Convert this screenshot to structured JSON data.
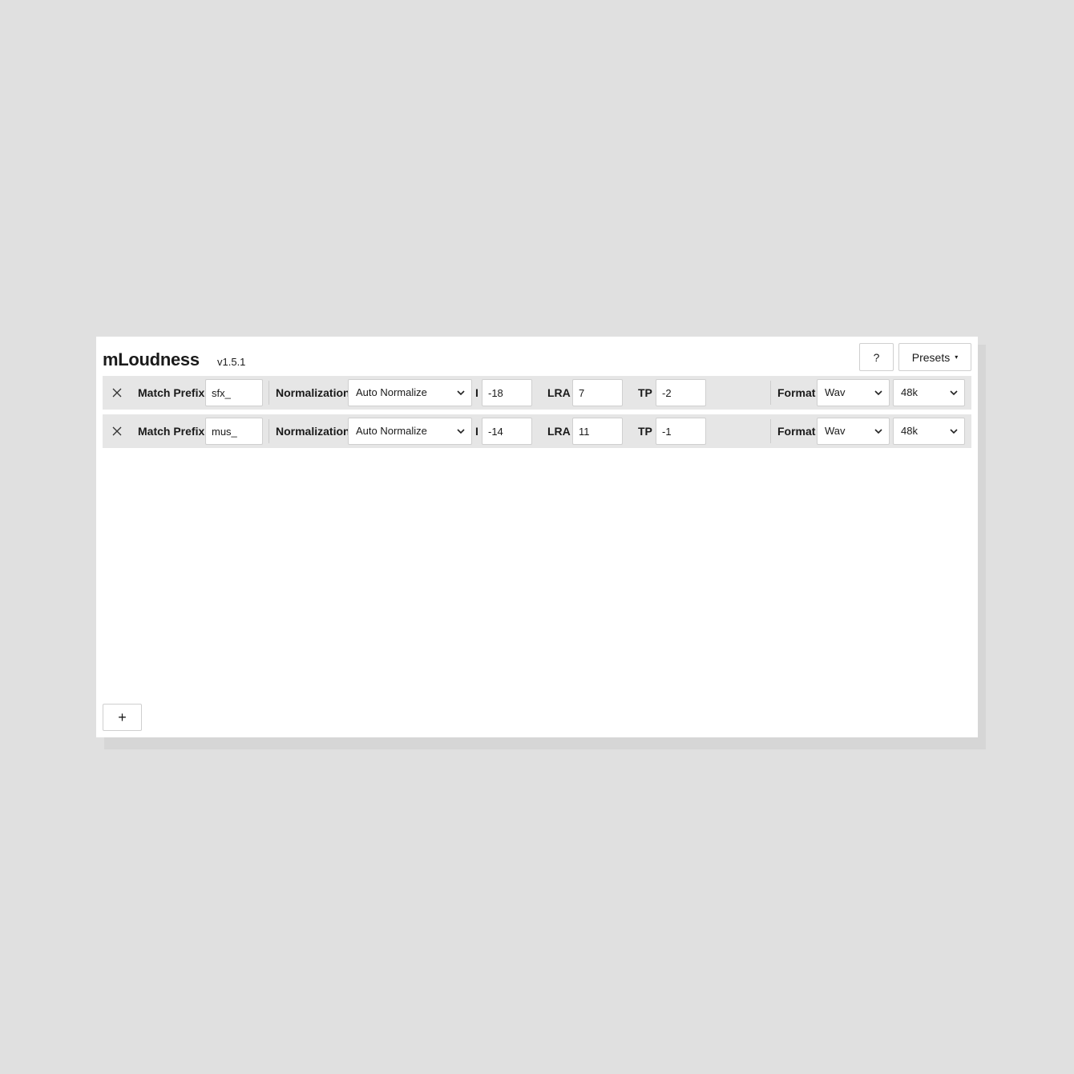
{
  "header": {
    "title": "mLoudness",
    "version": "v1.5.1",
    "help_label": "?",
    "presets_label": "Presets",
    "presets_caret": "▾"
  },
  "rows": [
    {
      "remove_label": "×",
      "match_prefix_label": "Match Prefix",
      "match_prefix_value": "sfx_",
      "normalization_label": "Normalization",
      "normalization_value": "Auto Normalize",
      "i_label": "I",
      "i_value": "-18",
      "lra_label": "LRA",
      "lra_value": "7",
      "tp_label": "TP",
      "tp_value": "-2",
      "format_label": "Format",
      "format_value": "Wav",
      "sample_rate_value": "48k"
    },
    {
      "remove_label": "×",
      "match_prefix_label": "Match Prefix",
      "match_prefix_value": "mus_",
      "normalization_label": "Normalization",
      "normalization_value": "Auto Normalize",
      "i_label": "I",
      "i_value": "-14",
      "lra_label": "LRA",
      "lra_value": "11",
      "tp_label": "TP",
      "tp_value": "-1",
      "format_label": "Format",
      "format_value": "Wav",
      "sample_rate_value": "48k"
    }
  ],
  "footer": {
    "add_label": "+"
  },
  "icons": {
    "remove": "close-icon",
    "select": "chevron-down-icon",
    "presets": "caret-down-icon"
  }
}
